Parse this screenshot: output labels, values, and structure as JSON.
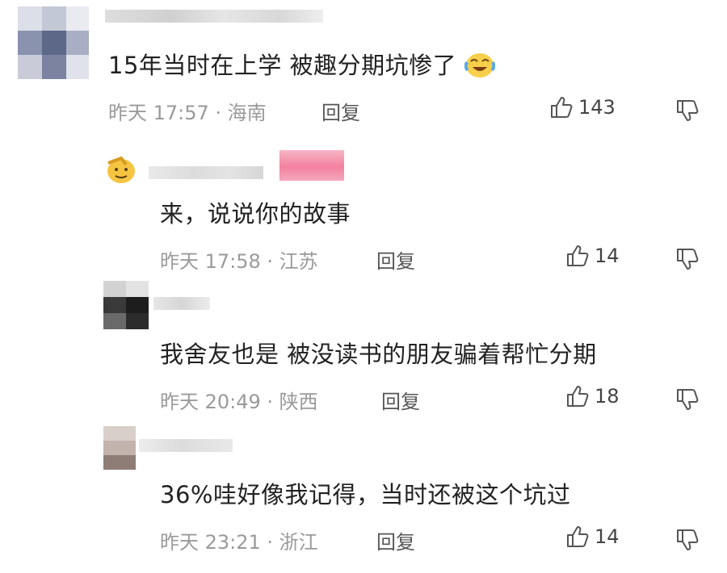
{
  "comments": [
    {
      "text": "15年当时在上学 被趣分期坑惨了",
      "time": "昨天 17:57 · 海南",
      "reply": "回复",
      "likes": "143"
    },
    {
      "text": "来，说说你的故事",
      "time": "昨天 17:58 · 江苏",
      "reply": "回复",
      "likes": "14"
    },
    {
      "text": "我舍友也是 被没读书的朋友骗着帮忙分期",
      "time": "昨天 20:49 · 陕西",
      "reply": "回复",
      "likes": "18"
    },
    {
      "text": "36%哇好像我记得，当时还被这个坑过",
      "time": "昨天 23:21 · 浙江",
      "reply": "回复",
      "likes": "14"
    }
  ],
  "icons": {
    "like": "thumbs-up-icon",
    "dislike": "thumbs-down-icon",
    "emoji": "laughing-crying-emoji-icon",
    "badge": "salute-emoji-icon"
  },
  "colors": {
    "meta": "#9a9a9a",
    "text": "#222222",
    "badge": "#f06a8a"
  }
}
